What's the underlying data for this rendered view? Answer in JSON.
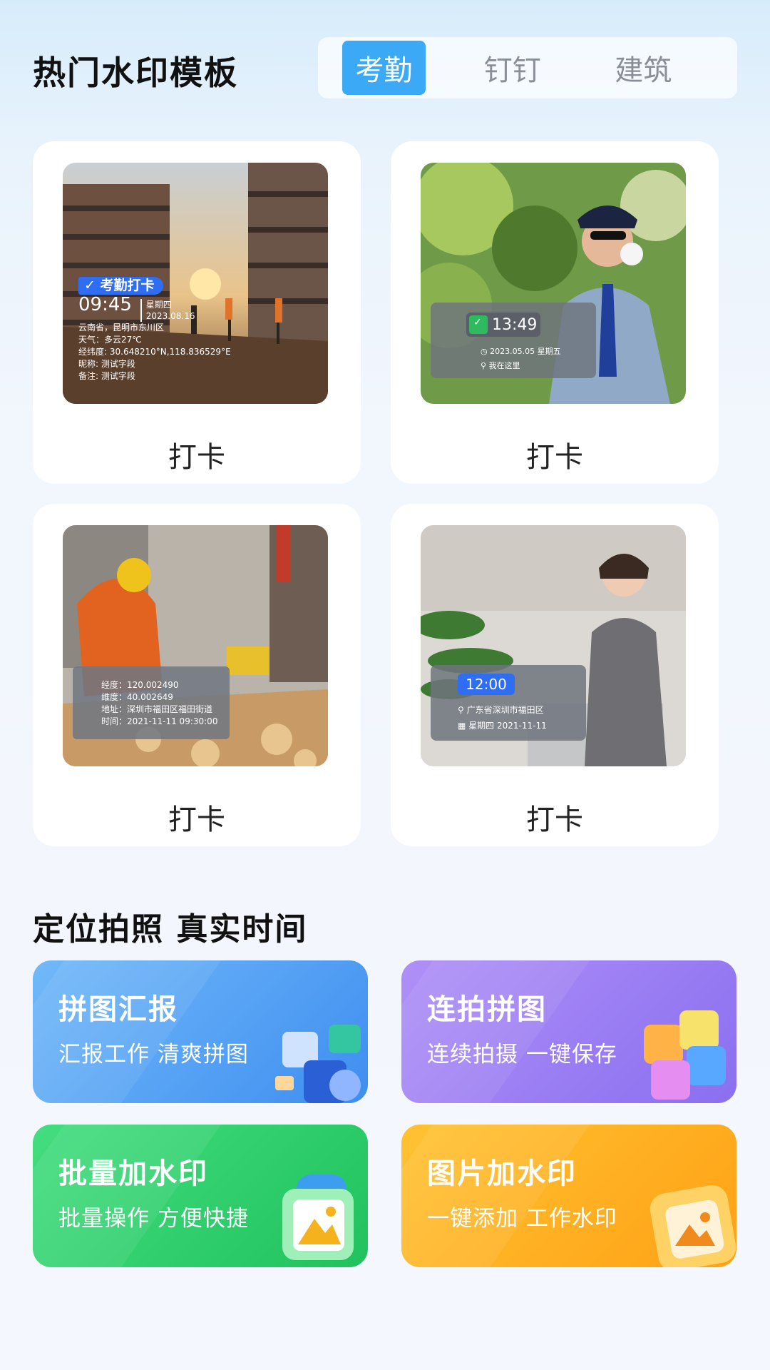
{
  "header": {
    "title": "热门水印模板",
    "tabs": [
      {
        "label": "考勤",
        "active": true
      },
      {
        "label": "钉钉",
        "active": false
      },
      {
        "label": "建筑",
        "active": false
      }
    ]
  },
  "templates": [
    {
      "label": "打卡",
      "watermark": {
        "badge": "考勤打卡",
        "time": "09:45",
        "weekday": "星期四",
        "date": "2023.08.16",
        "lines": [
          "云南省，昆明市东川区",
          "天气：多云27℃",
          "经纬度: 30.648210°N,118.836529°E",
          "昵称: 测试字段",
          "备注: 测试字段"
        ]
      }
    },
    {
      "label": "打卡",
      "watermark": {
        "time": "13:49",
        "cal_text": "打卡",
        "date_line": "2023.05.05 星期五",
        "loc_line": "我在这里"
      }
    },
    {
      "label": "打卡",
      "watermark": {
        "lines": [
          "经度：120.002490",
          "维度：40.002649",
          "地址：深圳市福田区福田街道",
          "时间：2021-11-11 09:30:00"
        ]
      }
    },
    {
      "label": "打卡",
      "watermark": {
        "time": "12:00",
        "loc_line": "广东省深圳市福田区",
        "date_line": "星期四  2021-11-11"
      }
    }
  ],
  "section": {
    "title": "定位拍照 真实时间"
  },
  "features": [
    {
      "title": "拼图汇报",
      "subtitle": "汇报工作 清爽拼图",
      "color_from": "#6ab4f8",
      "color_to": "#3f8ff0"
    },
    {
      "title": "连拍拼图",
      "subtitle": "连续拍摄 一键保存",
      "color_from": "#a98af6",
      "color_to": "#8a6ef0"
    },
    {
      "title": "批量加水印",
      "subtitle": "批量操作 方便快捷",
      "color_from": "#3ddb7a",
      "color_to": "#22c460"
    },
    {
      "title": "图片加水印",
      "subtitle": "一键添加 工作水印",
      "color_from": "#ffbf2f",
      "color_to": "#ffa214"
    }
  ]
}
